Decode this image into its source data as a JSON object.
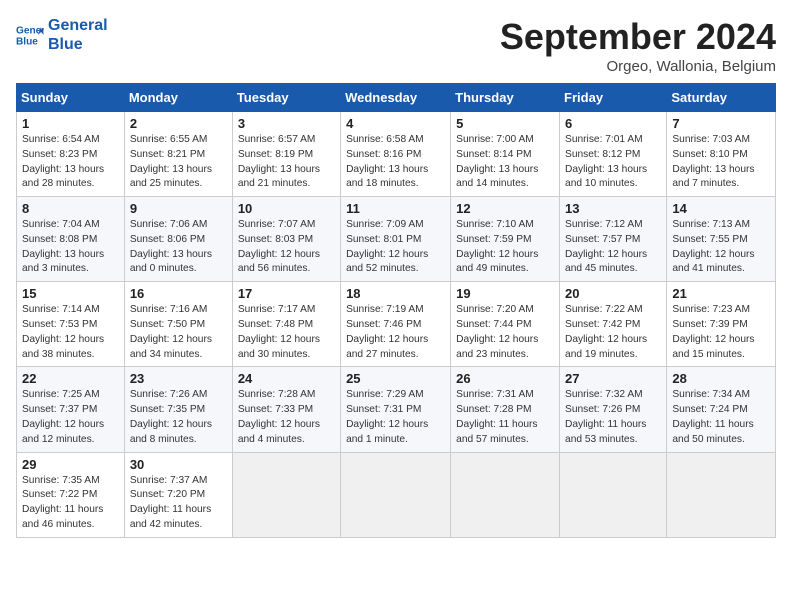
{
  "header": {
    "logo_line1": "General",
    "logo_line2": "Blue",
    "month": "September 2024",
    "location": "Orgeo, Wallonia, Belgium"
  },
  "weekdays": [
    "Sunday",
    "Monday",
    "Tuesday",
    "Wednesday",
    "Thursday",
    "Friday",
    "Saturday"
  ],
  "weeks": [
    [
      {
        "day": "1",
        "info": "Sunrise: 6:54 AM\nSunset: 8:23 PM\nDaylight: 13 hours\nand 28 minutes."
      },
      {
        "day": "2",
        "info": "Sunrise: 6:55 AM\nSunset: 8:21 PM\nDaylight: 13 hours\nand 25 minutes."
      },
      {
        "day": "3",
        "info": "Sunrise: 6:57 AM\nSunset: 8:19 PM\nDaylight: 13 hours\nand 21 minutes."
      },
      {
        "day": "4",
        "info": "Sunrise: 6:58 AM\nSunset: 8:16 PM\nDaylight: 13 hours\nand 18 minutes."
      },
      {
        "day": "5",
        "info": "Sunrise: 7:00 AM\nSunset: 8:14 PM\nDaylight: 13 hours\nand 14 minutes."
      },
      {
        "day": "6",
        "info": "Sunrise: 7:01 AM\nSunset: 8:12 PM\nDaylight: 13 hours\nand 10 minutes."
      },
      {
        "day": "7",
        "info": "Sunrise: 7:03 AM\nSunset: 8:10 PM\nDaylight: 13 hours\nand 7 minutes."
      }
    ],
    [
      {
        "day": "8",
        "info": "Sunrise: 7:04 AM\nSunset: 8:08 PM\nDaylight: 13 hours\nand 3 minutes."
      },
      {
        "day": "9",
        "info": "Sunrise: 7:06 AM\nSunset: 8:06 PM\nDaylight: 13 hours\nand 0 minutes."
      },
      {
        "day": "10",
        "info": "Sunrise: 7:07 AM\nSunset: 8:03 PM\nDaylight: 12 hours\nand 56 minutes."
      },
      {
        "day": "11",
        "info": "Sunrise: 7:09 AM\nSunset: 8:01 PM\nDaylight: 12 hours\nand 52 minutes."
      },
      {
        "day": "12",
        "info": "Sunrise: 7:10 AM\nSunset: 7:59 PM\nDaylight: 12 hours\nand 49 minutes."
      },
      {
        "day": "13",
        "info": "Sunrise: 7:12 AM\nSunset: 7:57 PM\nDaylight: 12 hours\nand 45 minutes."
      },
      {
        "day": "14",
        "info": "Sunrise: 7:13 AM\nSunset: 7:55 PM\nDaylight: 12 hours\nand 41 minutes."
      }
    ],
    [
      {
        "day": "15",
        "info": "Sunrise: 7:14 AM\nSunset: 7:53 PM\nDaylight: 12 hours\nand 38 minutes."
      },
      {
        "day": "16",
        "info": "Sunrise: 7:16 AM\nSunset: 7:50 PM\nDaylight: 12 hours\nand 34 minutes."
      },
      {
        "day": "17",
        "info": "Sunrise: 7:17 AM\nSunset: 7:48 PM\nDaylight: 12 hours\nand 30 minutes."
      },
      {
        "day": "18",
        "info": "Sunrise: 7:19 AM\nSunset: 7:46 PM\nDaylight: 12 hours\nand 27 minutes."
      },
      {
        "day": "19",
        "info": "Sunrise: 7:20 AM\nSunset: 7:44 PM\nDaylight: 12 hours\nand 23 minutes."
      },
      {
        "day": "20",
        "info": "Sunrise: 7:22 AM\nSunset: 7:42 PM\nDaylight: 12 hours\nand 19 minutes."
      },
      {
        "day": "21",
        "info": "Sunrise: 7:23 AM\nSunset: 7:39 PM\nDaylight: 12 hours\nand 15 minutes."
      }
    ],
    [
      {
        "day": "22",
        "info": "Sunrise: 7:25 AM\nSunset: 7:37 PM\nDaylight: 12 hours\nand 12 minutes."
      },
      {
        "day": "23",
        "info": "Sunrise: 7:26 AM\nSunset: 7:35 PM\nDaylight: 12 hours\nand 8 minutes."
      },
      {
        "day": "24",
        "info": "Sunrise: 7:28 AM\nSunset: 7:33 PM\nDaylight: 12 hours\nand 4 minutes."
      },
      {
        "day": "25",
        "info": "Sunrise: 7:29 AM\nSunset: 7:31 PM\nDaylight: 12 hours\nand 1 minute."
      },
      {
        "day": "26",
        "info": "Sunrise: 7:31 AM\nSunset: 7:28 PM\nDaylight: 11 hours\nand 57 minutes."
      },
      {
        "day": "27",
        "info": "Sunrise: 7:32 AM\nSunset: 7:26 PM\nDaylight: 11 hours\nand 53 minutes."
      },
      {
        "day": "28",
        "info": "Sunrise: 7:34 AM\nSunset: 7:24 PM\nDaylight: 11 hours\nand 50 minutes."
      }
    ],
    [
      {
        "day": "29",
        "info": "Sunrise: 7:35 AM\nSunset: 7:22 PM\nDaylight: 11 hours\nand 46 minutes."
      },
      {
        "day": "30",
        "info": "Sunrise: 7:37 AM\nSunset: 7:20 PM\nDaylight: 11 hours\nand 42 minutes."
      },
      {
        "day": "",
        "info": ""
      },
      {
        "day": "",
        "info": ""
      },
      {
        "day": "",
        "info": ""
      },
      {
        "day": "",
        "info": ""
      },
      {
        "day": "",
        "info": ""
      }
    ]
  ]
}
